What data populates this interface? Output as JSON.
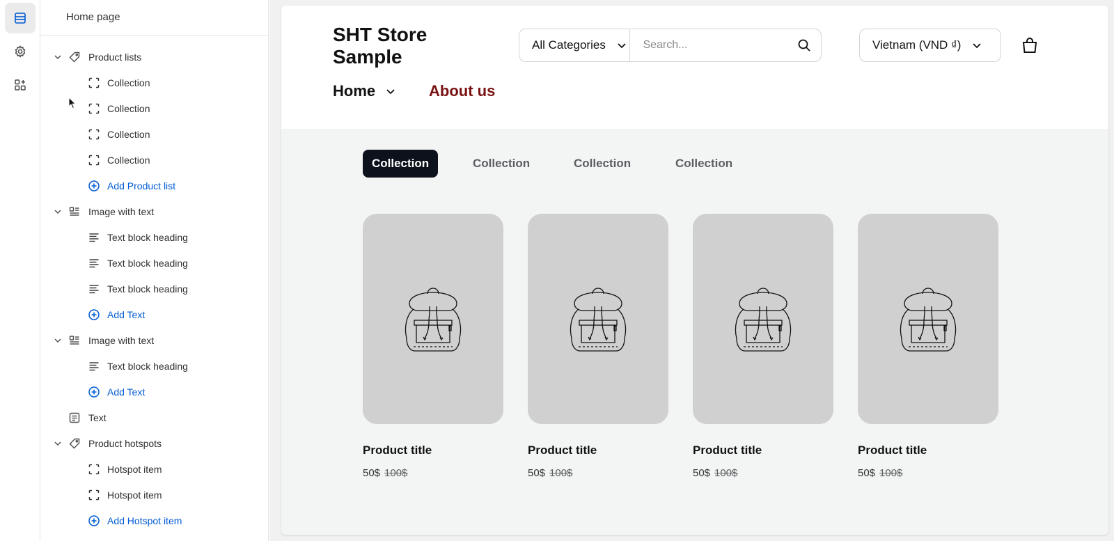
{
  "sidebar": {
    "header_title": "Home page",
    "rail_icons": [
      "sections-icon",
      "gear-icon",
      "apps-icon"
    ],
    "tree": [
      {
        "level": 0,
        "label": "Product lists",
        "icon": "tag-icon",
        "expanded": true
      },
      {
        "level": 1,
        "label": "Collection",
        "icon": "dashed-square-icon"
      },
      {
        "level": 1,
        "label": "Collection",
        "icon": "dashed-square-icon"
      },
      {
        "level": 1,
        "label": "Collection",
        "icon": "dashed-square-icon"
      },
      {
        "level": 1,
        "label": "Collection",
        "icon": "dashed-square-icon"
      },
      {
        "level": 1,
        "label": "Add Product list",
        "icon": "plus-circle-icon",
        "add": true
      },
      {
        "level": 0,
        "label": "Image with text",
        "icon": "image-text-icon",
        "expanded": true
      },
      {
        "level": 1,
        "label": "Text block heading",
        "icon": "text-lines-icon"
      },
      {
        "level": 1,
        "label": "Text block heading",
        "icon": "text-lines-icon"
      },
      {
        "level": 1,
        "label": "Text block heading",
        "icon": "text-lines-icon"
      },
      {
        "level": 1,
        "label": "Add Text",
        "icon": "plus-circle-icon",
        "add": true
      },
      {
        "level": 0,
        "label": "Image with text",
        "icon": "image-text-icon",
        "expanded": true
      },
      {
        "level": 1,
        "label": "Text block heading",
        "icon": "text-lines-icon"
      },
      {
        "level": 1,
        "label": "Add Text",
        "icon": "plus-circle-icon",
        "add": true
      },
      {
        "level": 0,
        "label": "Text",
        "icon": "text-box-icon",
        "expanded": false
      },
      {
        "level": 0,
        "label": "Product hotspots",
        "icon": "tag-icon",
        "expanded": true
      },
      {
        "level": 1,
        "label": "Hotspot item",
        "icon": "dashed-square-icon"
      },
      {
        "level": 1,
        "label": "Hotspot item",
        "icon": "dashed-square-icon"
      },
      {
        "level": 1,
        "label": "Add Hotspot item",
        "icon": "plus-circle-icon",
        "add": true
      }
    ]
  },
  "store": {
    "title": "SHT Store Sample",
    "category_select": "All Categories",
    "search_placeholder": "Search...",
    "currency": "Vietnam (VND ₫)",
    "nav": {
      "home": "Home",
      "about": "About us"
    },
    "tabs": [
      {
        "label": "Collection",
        "active": true
      },
      {
        "label": "Collection",
        "active": false
      },
      {
        "label": "Collection",
        "active": false
      },
      {
        "label": "Collection",
        "active": false
      }
    ],
    "products": [
      {
        "title": "Product title",
        "price": "50$",
        "compare_price": "100$"
      },
      {
        "title": "Product title",
        "price": "50$",
        "compare_price": "100$"
      },
      {
        "title": "Product title",
        "price": "50$",
        "compare_price": "100$"
      },
      {
        "title": "Product title",
        "price": "50$",
        "compare_price": "100$"
      }
    ]
  },
  "colors": {
    "accent_blue": "#005bd3",
    "about_link": "#7a1212",
    "active_tab_bg": "#0c111b",
    "product_image_bg": "#d0d0d0",
    "preview_bg": "#f3f4f4"
  }
}
